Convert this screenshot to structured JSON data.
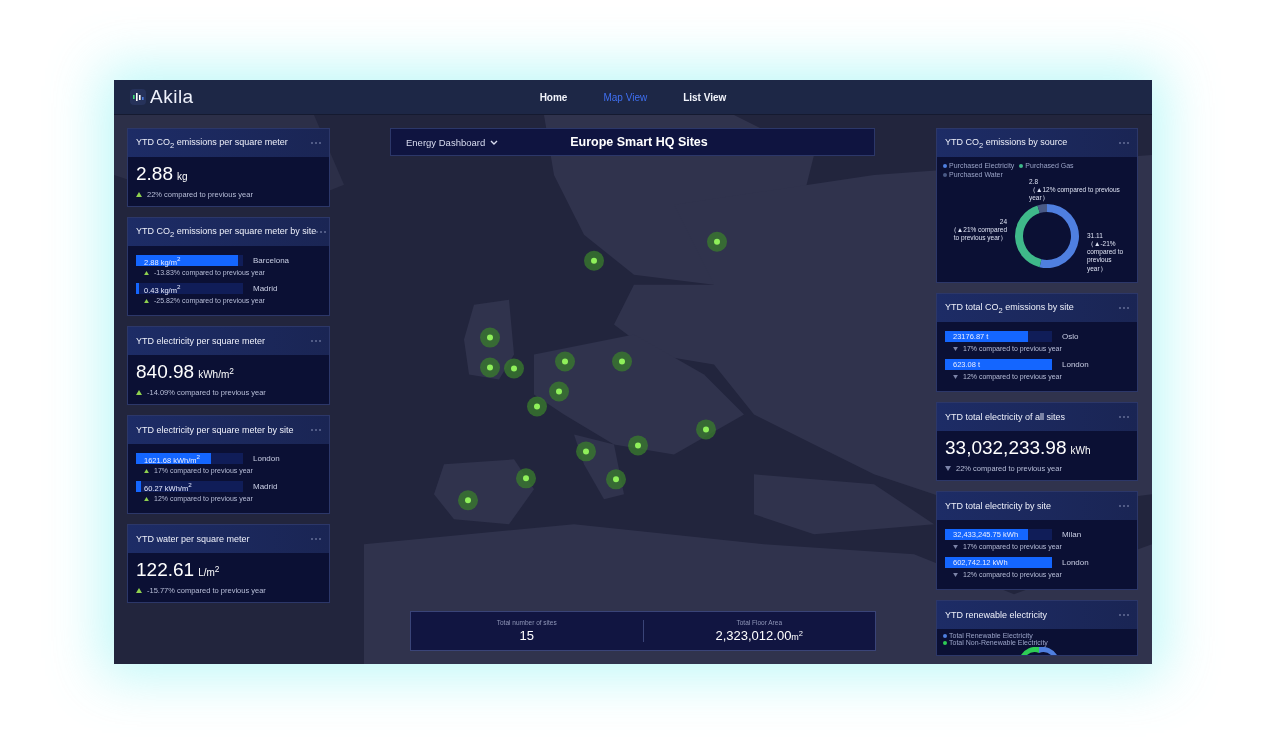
{
  "header": {
    "logo": "Akila",
    "nav": [
      {
        "label": "Home",
        "selected": false
      },
      {
        "label": "Map View",
        "selected": true
      },
      {
        "label": "List View",
        "selected": false
      }
    ]
  },
  "map_bar": {
    "dropdown": "Energy Dashboard",
    "title": "Europe Smart HQ Sites"
  },
  "left_panels": [
    {
      "kind": "metric",
      "title": "YTD CO$_{2}$ emissions per square meter",
      "value": "2.88",
      "unit": "kg",
      "increase": true,
      "change": "22% compared to previous year"
    },
    {
      "kind": "bars",
      "title": "YTD CO$_{2}$ emissions per square meter by site",
      "rows": [
        {
          "value": "2.88 kg/m$^{2}$",
          "level": 0.95,
          "site": "Barcelona",
          "increase": true,
          "change": "-13.83% compared to previous year"
        },
        {
          "value": "0.43 kg/m$^{2}$",
          "level": 0.03,
          "site": "Madrid",
          "increase": true,
          "change": "-25.82% compared to previous year"
        }
      ]
    },
    {
      "kind": "metric",
      "title": "YTD electricity per square meter",
      "value": "840.98",
      "unit": "kWh/m$^{2}$",
      "increase": true,
      "change": "-14.09% compared to previous year"
    },
    {
      "kind": "bars",
      "title": "YTD electricity per square meter by site",
      "rows": [
        {
          "value": "1621.68 kWh/m$^{2}$",
          "level": 0.7,
          "site": "London",
          "increase": true,
          "change": "17% compared to previous year"
        },
        {
          "value": "60.27 kWh/m$^{2}$",
          "level": 0.05,
          "site": "Madrid",
          "increase": true,
          "change": "12% compared to previous year"
        }
      ]
    },
    {
      "kind": "metric",
      "title": "YTD water per square meter",
      "value": "122.61",
      "unit": "L/m$^{2}$",
      "increase": true,
      "change": "-15.77% compared to previous year"
    }
  ],
  "right_panels": [
    {
      "kind": "donut",
      "title": "YTD CO$_{2}$ emissions by source",
      "legend": [
        {
          "color": "#4f7fe0"
        },
        {
          "color": "#3fb98a"
        },
        {
          "color": "#4a5a86"
        }
      ],
      "notes": [
        "（▲-21% compared to previous year）",
        "（▲21% compared to previous year）",
        "（▲12% compared to previous year）"
      ],
      "chart_data": {
        "type": "donut",
        "categories": [
          "Purchased Electricity",
          "Purchased Gas",
          "Purchased Water"
        ],
        "series": [
          {
            "values": [
              31.11,
              24,
              2.8
            ]
          }
        ],
        "data_labels": true
      }
    },
    {
      "kind": "bars",
      "title": "YTD total CO$_{2}$ emissions by site",
      "rows": [
        {
          "value": "23176.87 t",
          "level": 0.78,
          "site": "Oslo",
          "increase": false,
          "change": "17% compared to previous year"
        },
        {
          "value": "623.08 t",
          "level": 1,
          "site": "London",
          "increase": false,
          "change": "12% compared to previous year"
        }
      ]
    },
    {
      "kind": "metric",
      "title": "YTD total electricity of all sites",
      "value": "33,032,233.98",
      "unit": "kWh",
      "increase": false,
      "change": "22% compared to previous year"
    },
    {
      "kind": "bars",
      "title": "YTD total electricity by site",
      "rows": [
        {
          "value": "32,433,245.75 kWh",
          "level": 0.78,
          "site": "Milan",
          "increase": false,
          "change": "17% compared to previous year"
        },
        {
          "value": "602,742.12 kWh",
          "level": 1,
          "site": "London",
          "increase": false,
          "change": "12% compared to previous year"
        }
      ]
    },
    {
      "kind": "partial",
      "title": "YTD renewable electricity",
      "legend": [
        {
          "label": "Total Renewable Electricity",
          "color": "#4f7fe0"
        },
        {
          "label": "Total Non-Renewable Electricity",
          "color": "#2ecc55"
        }
      ]
    }
  ],
  "summary": [
    {
      "label": "Total number of sites",
      "value": "15"
    },
    {
      "label": "Total Floor Area",
      "value": "2,323,012.00",
      "unit": "m$^{2}$"
    }
  ]
}
